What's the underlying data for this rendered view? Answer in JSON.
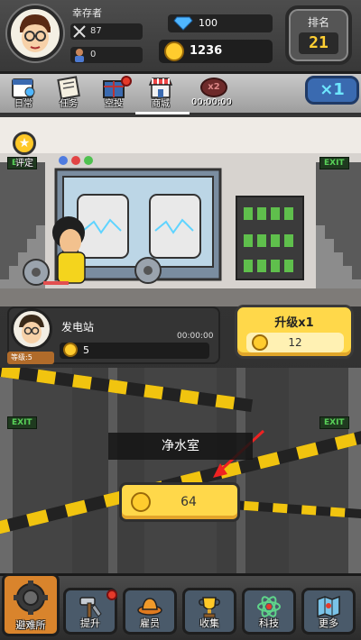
{
  "player": {
    "name": "幸存者",
    "attack": "87",
    "population": "0"
  },
  "resources": {
    "gems": "100",
    "gold": "1236"
  },
  "rank": {
    "label": "排名",
    "value": "21"
  },
  "menu": {
    "items": [
      {
        "label": "日常",
        "icon": "calendar-icon"
      },
      {
        "label": "任务",
        "icon": "task-scroll-icon"
      },
      {
        "label": "空投",
        "icon": "airdrop-crate-icon"
      },
      {
        "label": "商城",
        "icon": "shop-icon"
      }
    ],
    "x2_label": "x2",
    "timer": "00:00:00",
    "speed_label": "×1"
  },
  "rating": {
    "label": "评定"
  },
  "exit_label": "EXIT",
  "room1": {
    "name": "发电站",
    "timer": "00:00:00",
    "income": "5",
    "level": "等级:5",
    "upgrade_label": "升级x1",
    "upgrade_cost": "12"
  },
  "room2": {
    "name": "净水室",
    "build_cost": "64"
  },
  "nav": {
    "main": "避难所",
    "items": [
      {
        "label": "提升",
        "icon": "hammer-icon"
      },
      {
        "label": "雇员",
        "icon": "hat-icon"
      },
      {
        "label": "收集",
        "icon": "trophy-icon"
      },
      {
        "label": "科技",
        "icon": "atom-icon"
      },
      {
        "label": "更多",
        "icon": "map-icon"
      }
    ]
  },
  "colors": {
    "accent_yellow": "#ffd84a",
    "hazard_black": "#222222",
    "exit_green": "#58d158",
    "notification_red": "#e53a2a"
  }
}
